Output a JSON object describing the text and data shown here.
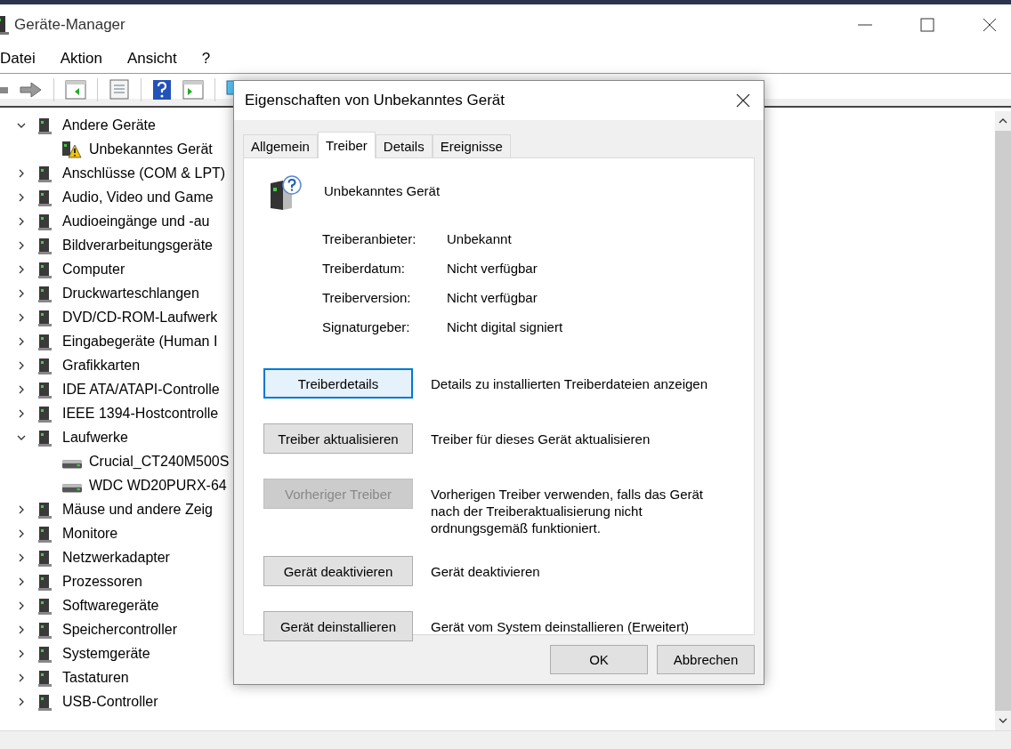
{
  "window": {
    "title": "Geräte-Manager"
  },
  "menu": [
    {
      "label": "Datei"
    },
    {
      "label": "Aktion"
    },
    {
      "label": "Ansicht"
    },
    {
      "label": "?"
    }
  ],
  "tree": [
    {
      "label": "Andere Geräte",
      "expanded": true,
      "children": [
        {
          "label": "Unbekanntes Gerät",
          "warning": true
        }
      ]
    },
    {
      "label": "Anschlüsse (COM & LPT)",
      "expanded": false
    },
    {
      "label": "Audio, Video und Game",
      "expanded": false
    },
    {
      "label": "Audioeingänge und -au",
      "expanded": false
    },
    {
      "label": "Bildverarbeitungsgeräte",
      "expanded": false
    },
    {
      "label": "Computer",
      "expanded": false
    },
    {
      "label": "Druckwarteschlangen",
      "expanded": false
    },
    {
      "label": "DVD/CD-ROM-Laufwerk",
      "expanded": false
    },
    {
      "label": "Eingabegeräte (Human I",
      "expanded": false
    },
    {
      "label": "Grafikkarten",
      "expanded": false
    },
    {
      "label": "IDE ATA/ATAPI-Controlle",
      "expanded": false
    },
    {
      "label": "IEEE 1394-Hostcontrolle",
      "expanded": false
    },
    {
      "label": "Laufwerke",
      "expanded": true,
      "children": [
        {
          "label": "Crucial_CT240M500S",
          "warning": false
        },
        {
          "label": "WDC WD20PURX-64",
          "warning": false
        }
      ]
    },
    {
      "label": "Mäuse und andere Zeig",
      "expanded": false
    },
    {
      "label": "Monitore",
      "expanded": false
    },
    {
      "label": "Netzwerkadapter",
      "expanded": false
    },
    {
      "label": "Prozessoren",
      "expanded": false
    },
    {
      "label": "Softwaregeräte",
      "expanded": false
    },
    {
      "label": "Speichercontroller",
      "expanded": false
    },
    {
      "label": "Systemgeräte",
      "expanded": false
    },
    {
      "label": "Tastaturen",
      "expanded": false
    },
    {
      "label": "USB-Controller",
      "expanded": false
    }
  ],
  "dialog": {
    "title": "Eigenschaften von Unbekanntes Gerät",
    "tabs": [
      {
        "label": "Allgemein",
        "selected": false
      },
      {
        "label": "Treiber",
        "selected": true
      },
      {
        "label": "Details",
        "selected": false
      },
      {
        "label": "Ereignisse",
        "selected": false
      }
    ],
    "device_name": "Unbekanntes Gerät",
    "info": [
      {
        "label": "Treiberanbieter:",
        "value": "Unbekannt"
      },
      {
        "label": "Treiberdatum:",
        "value": "Nicht verfügbar"
      },
      {
        "label": "Treiberversion:",
        "value": "Nicht verfügbar"
      },
      {
        "label": "Signaturgeber:",
        "value": "Nicht digital signiert"
      }
    ],
    "actions": [
      {
        "label": "Treiberdetails",
        "description": "Details zu installierten Treiberdateien anzeigen",
        "disabled": false,
        "focused": true
      },
      {
        "label": "Treiber aktualisieren",
        "description": "Treiber für dieses Gerät aktualisieren",
        "disabled": false,
        "focused": false
      },
      {
        "label": "Vorheriger Treiber",
        "description": "Vorherigen Treiber verwenden, falls das Gerät nach der Treiberaktualisierung nicht ordnungsgemäß funktioniert.",
        "disabled": true,
        "focused": false
      },
      {
        "label": "Gerät deaktivieren",
        "description": "Gerät deaktivieren",
        "disabled": false,
        "focused": false
      },
      {
        "label": "Gerät deinstallieren",
        "description": "Gerät vom System deinstallieren (Erweitert)",
        "disabled": false,
        "focused": false
      }
    ],
    "buttons": [
      {
        "label": "OK"
      },
      {
        "label": "Abbrechen"
      }
    ]
  }
}
